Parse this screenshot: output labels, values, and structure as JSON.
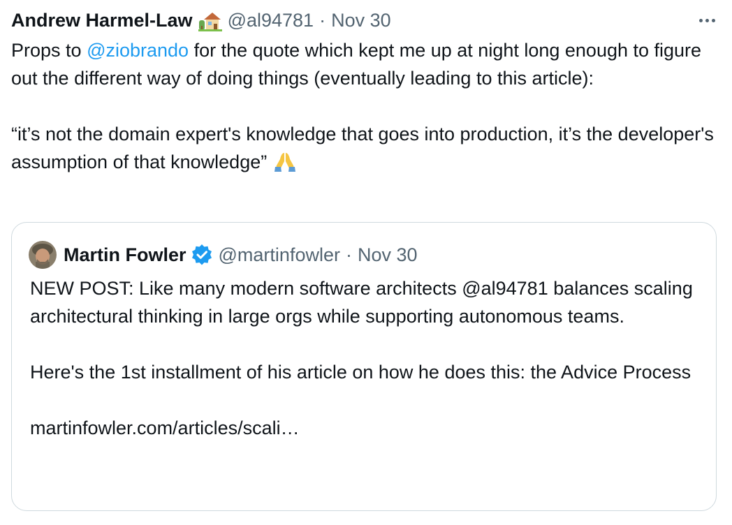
{
  "tweet": {
    "author_name": "Andrew Harmel-Law",
    "author_badge_icon": "house-with-garden-icon",
    "handle": "@al94781",
    "separator": "·",
    "date": "Nov 30",
    "more_icon": "more-horizontal-icon",
    "text": {
      "line1_prefix": "Props to ",
      "mention": "@ziobrando",
      "line1_suffix": " for the quote which kept me up at night long enough to figure out the different way of doing things (eventually leading to this article):",
      "quote_text": "“it’s not the domain expert's knowledge that goes into production, it’s the developer's assumption of that knowledge”",
      "emoji_icon": "folded-hands-icon"
    }
  },
  "quoted_tweet": {
    "author_name": "Martin Fowler",
    "verified_icon": "verified-badge-icon",
    "handle": "@martinfowler",
    "separator": "·",
    "date": "Nov 30",
    "paragraph1": "NEW POST: Like many modern software architects @al94781 balances scaling architectural thinking in large orgs while supporting autonomous teams.",
    "paragraph2": "Here's the 1st installment of his article on how he does this: the Advice Process",
    "link": "martinfowler.com/articles/scali…"
  },
  "colors": {
    "text": "#0f1419",
    "secondary": "#536471",
    "accent": "#1d9bf0",
    "border": "#cfd9de"
  }
}
